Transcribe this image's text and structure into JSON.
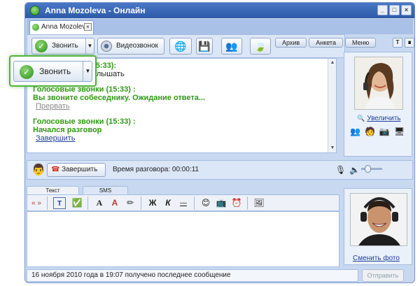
{
  "window": {
    "title": "Anna Mozoleva - Онлайн",
    "controls": [
      "_",
      "□",
      "×"
    ]
  },
  "tab": {
    "label": "Anna Mozoleva"
  },
  "toolbar": {
    "call_label": "Звонить",
    "video_label": "Видеозвонок",
    "right_tabs": [
      "Архив",
      "Анкета",
      "Меню"
    ],
    "right_icons": [
      "T",
      "∎"
    ]
  },
  "chat": {
    "messages": [
      {
        "header": "(15:33):",
        "text": "услышать",
        "partial": true
      },
      {
        "header": "Голосовые звонки (15:33) :",
        "text": "Вы звоните собеседнику. Ожидание ответа...",
        "link": "Прервать",
        "link_gray": true
      },
      {
        "header": "Голосовые звонки (15:33) :",
        "text": "Начался разговор",
        "link": "Завершить",
        "link_gray": false
      }
    ]
  },
  "contact_photo": {
    "enlarge_label": "Увеличить"
  },
  "callbar": {
    "end_label": "Завершить",
    "duration_label": "Время разговора: 00:00:11",
    "volume_level": 0.3
  },
  "message_tabs": [
    "Текст",
    "SMS"
  ],
  "format": {
    "bold": "Ж",
    "italic": "К",
    "quote": "« »"
  },
  "my_photo": {
    "change_label": "Сменить фото"
  },
  "status": {
    "text": "16 ноября 2010 года в 19:07 получено последнее сообщение"
  },
  "send_label": "Отправить",
  "callout": {
    "label": "Звонить"
  },
  "colors": {
    "accent_green": "#2f9a13",
    "link_blue": "#1f3f9d",
    "title_blue": "#2d5aa8"
  }
}
